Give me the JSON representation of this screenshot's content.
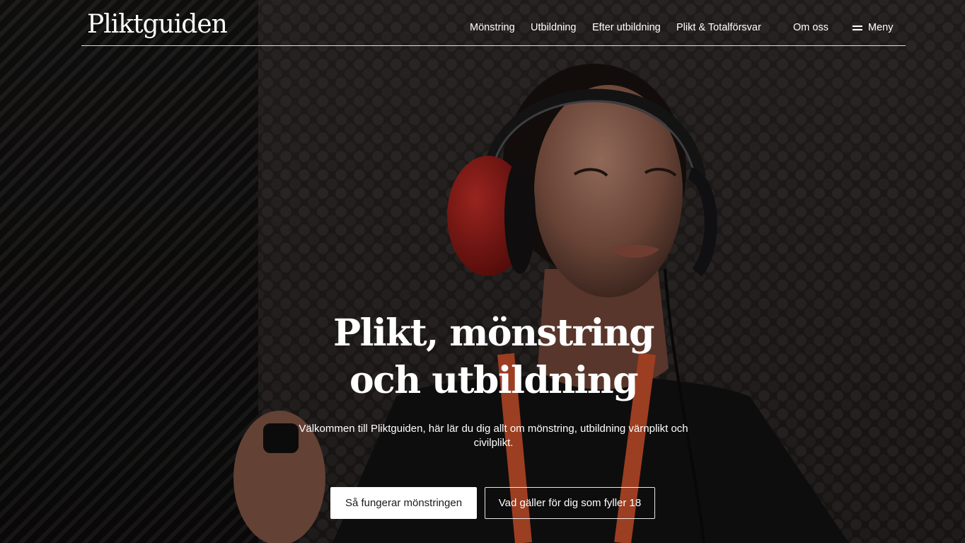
{
  "site": {
    "logo": "Pliktguiden"
  },
  "nav": {
    "items": [
      {
        "label": "Mönstring"
      },
      {
        "label": "Utbildning"
      },
      {
        "label": "Efter utbildning"
      },
      {
        "label": "Plikt & Totalförsvar"
      },
      {
        "label": "Om oss"
      }
    ],
    "menu_label": "Meny"
  },
  "hero": {
    "title_line1": "Plikt, mönstring",
    "title_line2": "och utbildning",
    "intro": "Välkommen till Pliktguiden, här lär du dig allt om mönstring, utbildning värnplikt och civilplikt.",
    "primary_button": "Så fungerar mönstringen",
    "secondary_button": "Vad gäller för dig som fyller 18"
  },
  "colors": {
    "text": "#ffffff",
    "primary_button_bg": "#ffffff",
    "primary_button_text": "#1a1a1a",
    "earmuff_red": "#b3201c",
    "lanyard_orange": "#d9562e"
  },
  "icons": {
    "menu": "hamburger-icon"
  }
}
